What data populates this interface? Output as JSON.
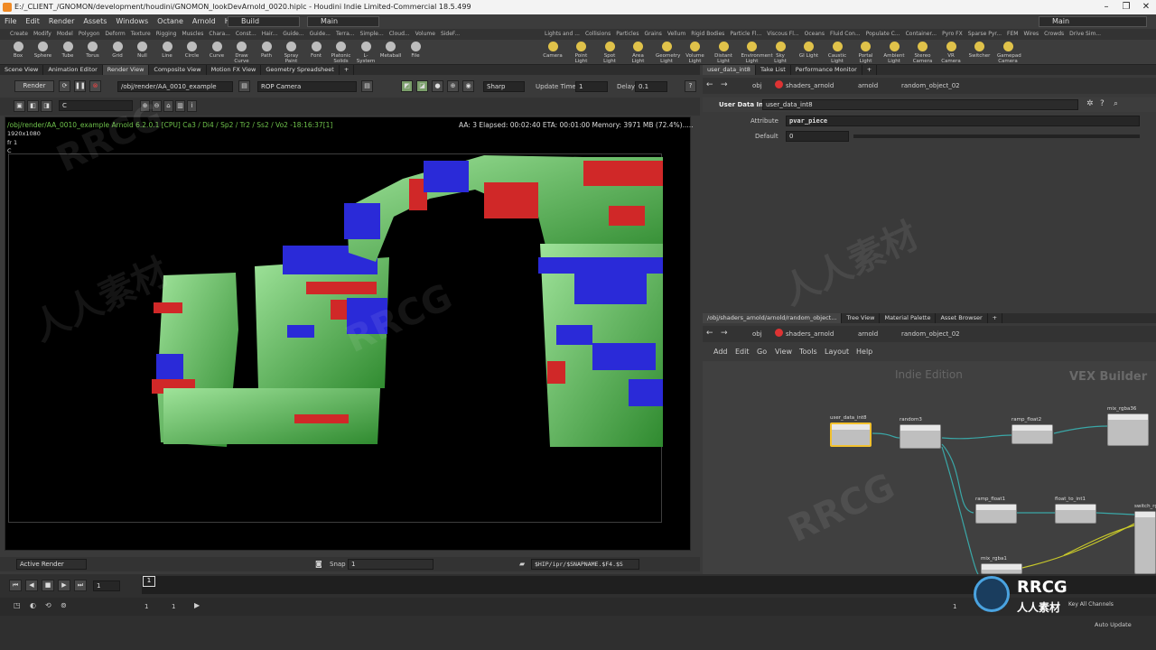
{
  "window": {
    "title": "E:/_CLIENT_/GNOMON/development/houdini/GNOMON_lookDevArnold_0020.hiplc - Houdini Indie Limited-Commercial 18.5.499",
    "controls": [
      "–",
      "❐",
      "✕"
    ]
  },
  "menu": {
    "items": [
      "File",
      "Edit",
      "Render",
      "Assets",
      "Windows",
      "Octane",
      "Arnold",
      "Help"
    ],
    "desktop": "Build",
    "workspace": "Main",
    "right_workspace": "Main"
  },
  "shelf": {
    "left_tabs": [
      "Create",
      "Modify",
      "Model",
      "Polygon",
      "Deform",
      "Texture",
      "Rigging",
      "Muscles",
      "Chara...",
      "Const...",
      "Hair...",
      "Guide...",
      "Guide...",
      "Terra...",
      "Simple...",
      "Cloud...",
      "Volume",
      "SideF..."
    ],
    "left_tools": [
      "Box",
      "Sphere",
      "Tube",
      "Torus",
      "Grid",
      "Null",
      "Line",
      "Circle",
      "Curve",
      "Draw Curve",
      "Path",
      "Spray Paint",
      "Font",
      "Platonic Solids",
      "L-System",
      "Metaball",
      "File"
    ],
    "right_tabs": [
      "Lights and ...",
      "Collisions",
      "Particles",
      "Grains",
      "Vellum",
      "Rigid Bodies",
      "Particle Fl...",
      "Viscous Fl...",
      "Oceans",
      "Fluid Con...",
      "Populate C...",
      "Container...",
      "Pyro FX",
      "Sparse Pyr...",
      "FEM",
      "Wires",
      "Crowds",
      "Drive Sim..."
    ],
    "right_tools": [
      "Camera",
      "Point Light",
      "Spot Light",
      "Area Light",
      "Geometry Light",
      "Volume Light",
      "Distant Light",
      "Environment Light",
      "Sky Light",
      "GI Light",
      "Caustic Light",
      "Portal Light",
      "Ambient Light",
      "Stereo Camera",
      "VR Camera",
      "Switcher",
      "Gamepad Camera"
    ]
  },
  "left_pane": {
    "tabs": [
      "Scene View",
      "Animation Editor",
      "Render View",
      "Composite View",
      "Motion FX View",
      "Geometry Spreadsheet"
    ],
    "render_button": "Render",
    "render_path": "/obj/render/AA_0010_example",
    "camera": "ROP Camera",
    "filter": "Sharp",
    "update_time_label": "Update Time",
    "update_time": "1",
    "delay_label": "Delay",
    "delay": "0.1",
    "channel": "C",
    "overlay": {
      "line1": "/obj/render/AA_0010_example  Arnold 6.2.0.1 [CPU]  Ca3 / Di4 / Sp2 / Tr2 / Ss2 / Vo2 -18:16:37[1]",
      "resolution": "1920x1080",
      "frame": "fr 1",
      "channel": "C",
      "stats": "AA: 3   Elapsed: 00:02:40   ETA: 00:01:00   Memory: 3971 MB   (72.4%)....."
    },
    "bottom_bar": {
      "active_render": "Active Render",
      "snap_label": "Snap",
      "snap_value": "1",
      "snap_path": "$HIP/ipr/$SNAPNAME.$F4.$S"
    }
  },
  "params_pane": {
    "tabs": [
      "user_data_int8",
      "Take List",
      "Performance Monitor"
    ],
    "breadcrumb": [
      "obj",
      "shaders_arnold",
      "arnold",
      "random_object_02"
    ],
    "node_type": "User Data Int",
    "node_name": "user_data_int8",
    "attribute_label": "Attribute",
    "attribute_value": "pvar_piece",
    "default_label": "Default",
    "default_value": "0"
  },
  "network_pane": {
    "tabs": [
      "/obj/shaders_arnold/arnold/random_object...",
      "Tree View",
      "Material Palette",
      "Asset Browser"
    ],
    "breadcrumb": [
      "obj",
      "shaders_arnold",
      "arnold",
      "random_object_02"
    ],
    "menu": [
      "Add",
      "Edit",
      "Go",
      "View",
      "Tools",
      "Layout",
      "Help"
    ],
    "edition": "Indie Edition",
    "context": "VEX Builder",
    "nodes": [
      "user_data_int8",
      "random3",
      "ramp_float2",
      "mix_rgba36",
      "ramp_float1",
      "float_to_int1",
      "switch_rgba",
      "mix_rgba1"
    ]
  },
  "timeline": {
    "frame": "1",
    "marker": "1",
    "start": "1",
    "start2": "1",
    "end": "1",
    "auto_update": "Auto Update",
    "keys": "Key All Channels"
  },
  "watermarks": [
    "RRCG",
    "人人素材",
    "RRCG 人人素材"
  ],
  "colors": {
    "accent_green": "#6ec14b",
    "node_selected": "#f2c12e",
    "wire": "#3aa7a7"
  }
}
